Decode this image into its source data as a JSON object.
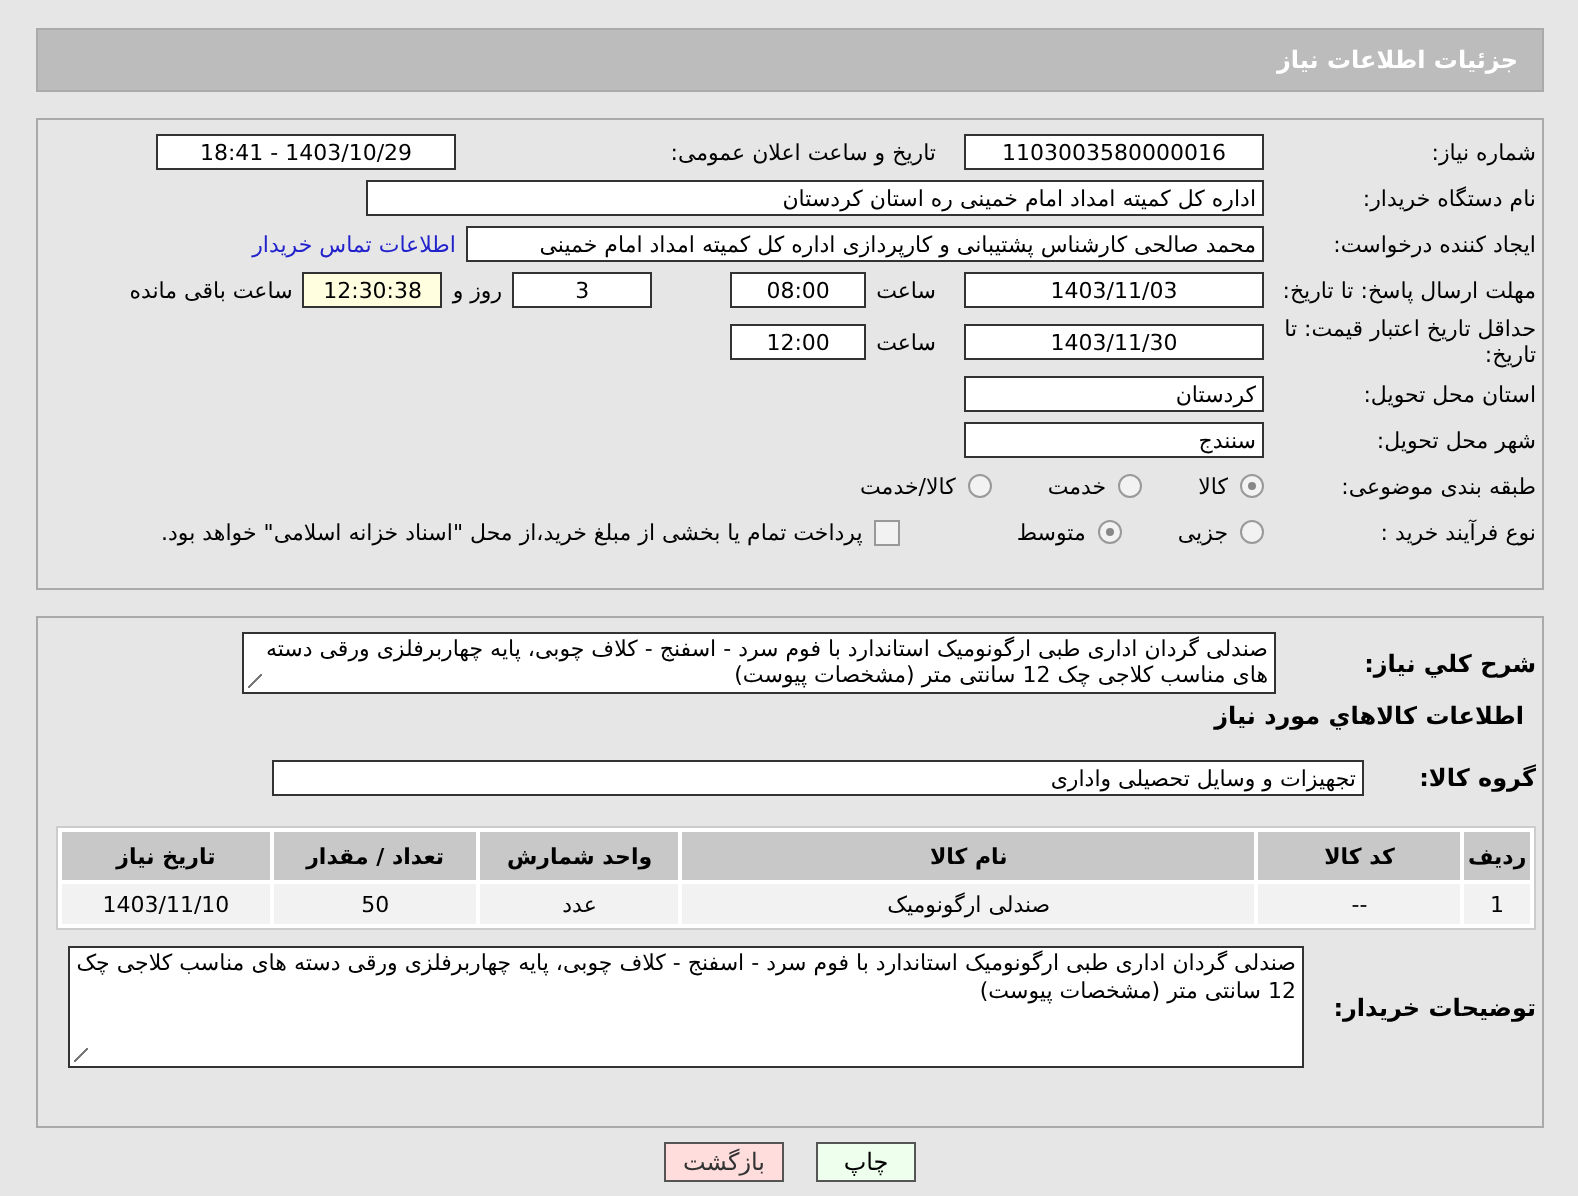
{
  "page_title": "جزئیات اطلاعات نیاز",
  "need_number": {
    "label": "شماره نیاز:",
    "value": "1103003580000016"
  },
  "announce": {
    "label": "تاریخ و ساعت اعلان عمومی:",
    "value": "1403/10/29 - 18:41"
  },
  "buyer_org": {
    "label": "نام دستگاه خریدار:",
    "value": "اداره کل کمیته امداد امام خمینی  ره  استان کردستان"
  },
  "requester": {
    "label": "ایجاد کننده درخواست:",
    "value": "محمد صالحی کارشناس پشتیبانی و کارپردازی اداره کل کمیته امداد امام خمینی",
    "link": "اطلاعات تماس خریدار"
  },
  "reply_deadline": {
    "label": "مهلت ارسال پاسخ: تا تاریخ:",
    "date": "1403/11/03",
    "time_label": "ساعت",
    "time": "08:00",
    "days": "3",
    "days_label": "روز و",
    "remaining": "12:30:38",
    "remaining_label": "ساعت باقی مانده"
  },
  "price_validity": {
    "label": "حداقل تاریخ اعتبار قیمت: تا تاریخ:",
    "date": "1403/11/30",
    "time_label": "ساعت",
    "time": "12:00"
  },
  "province": {
    "label": "استان محل تحویل:",
    "value": "کردستان"
  },
  "city": {
    "label": "شهر محل تحویل:",
    "value": "سنندج"
  },
  "category": {
    "label": "طبقه بندی موضوعی:",
    "options": [
      {
        "label": "کالا",
        "selected": true
      },
      {
        "label": "خدمت",
        "selected": false
      },
      {
        "label": "کالا/خدمت",
        "selected": false
      }
    ]
  },
  "process": {
    "label": "نوع فرآیند خرید :",
    "options": [
      {
        "label": "جزیی",
        "selected": false
      },
      {
        "label": "متوسط",
        "selected": true
      }
    ],
    "treasury": {
      "label": "پرداخت تمام یا بخشی از مبلغ خرید،از محل \"اسناد خزانه اسلامی\" خواهد بود.",
      "checked": false
    }
  },
  "summary": {
    "label": "شرح کلي نياز:",
    "value": "صندلی گردان اداری طبی ارگونومیک استاندارد با فوم سرد - اسفنج - کلاف چوبی، پایه چهاربرفلزی ورقی دسته های مناسب کلاجی چک 12 سانتی متر (مشخصات پیوست)"
  },
  "goods_heading": "اطلاعات كالاهاي مورد نياز",
  "goods_group": {
    "label": "گروه کالا:",
    "value": "تجهیزات و وسایل تحصیلی واداری"
  },
  "table": {
    "columns": [
      "ردیف",
      "کد کالا",
      "نام کالا",
      "واحد شمارش",
      "تعداد / مقدار",
      "تاریخ نیاز"
    ],
    "rows": [
      [
        "1",
        "--",
        "صندلی ارگونومیک",
        "عدد",
        "50",
        "1403/11/10"
      ]
    ]
  },
  "buyer_notes": {
    "label": "توضیحات خریدار:",
    "value": "صندلی گردان اداری طبی ارگونومیک استاندارد با فوم سرد - اسفنج - کلاف چوبی، پایه چهاربرفلزی ورقی دسته های مناسب کلاجی چک 12 سانتی متر (مشخصات پیوست)"
  },
  "buttons": [
    {
      "label": "چاپ",
      "kind": "print"
    },
    {
      "label": "بازگشت",
      "kind": "back"
    }
  ]
}
